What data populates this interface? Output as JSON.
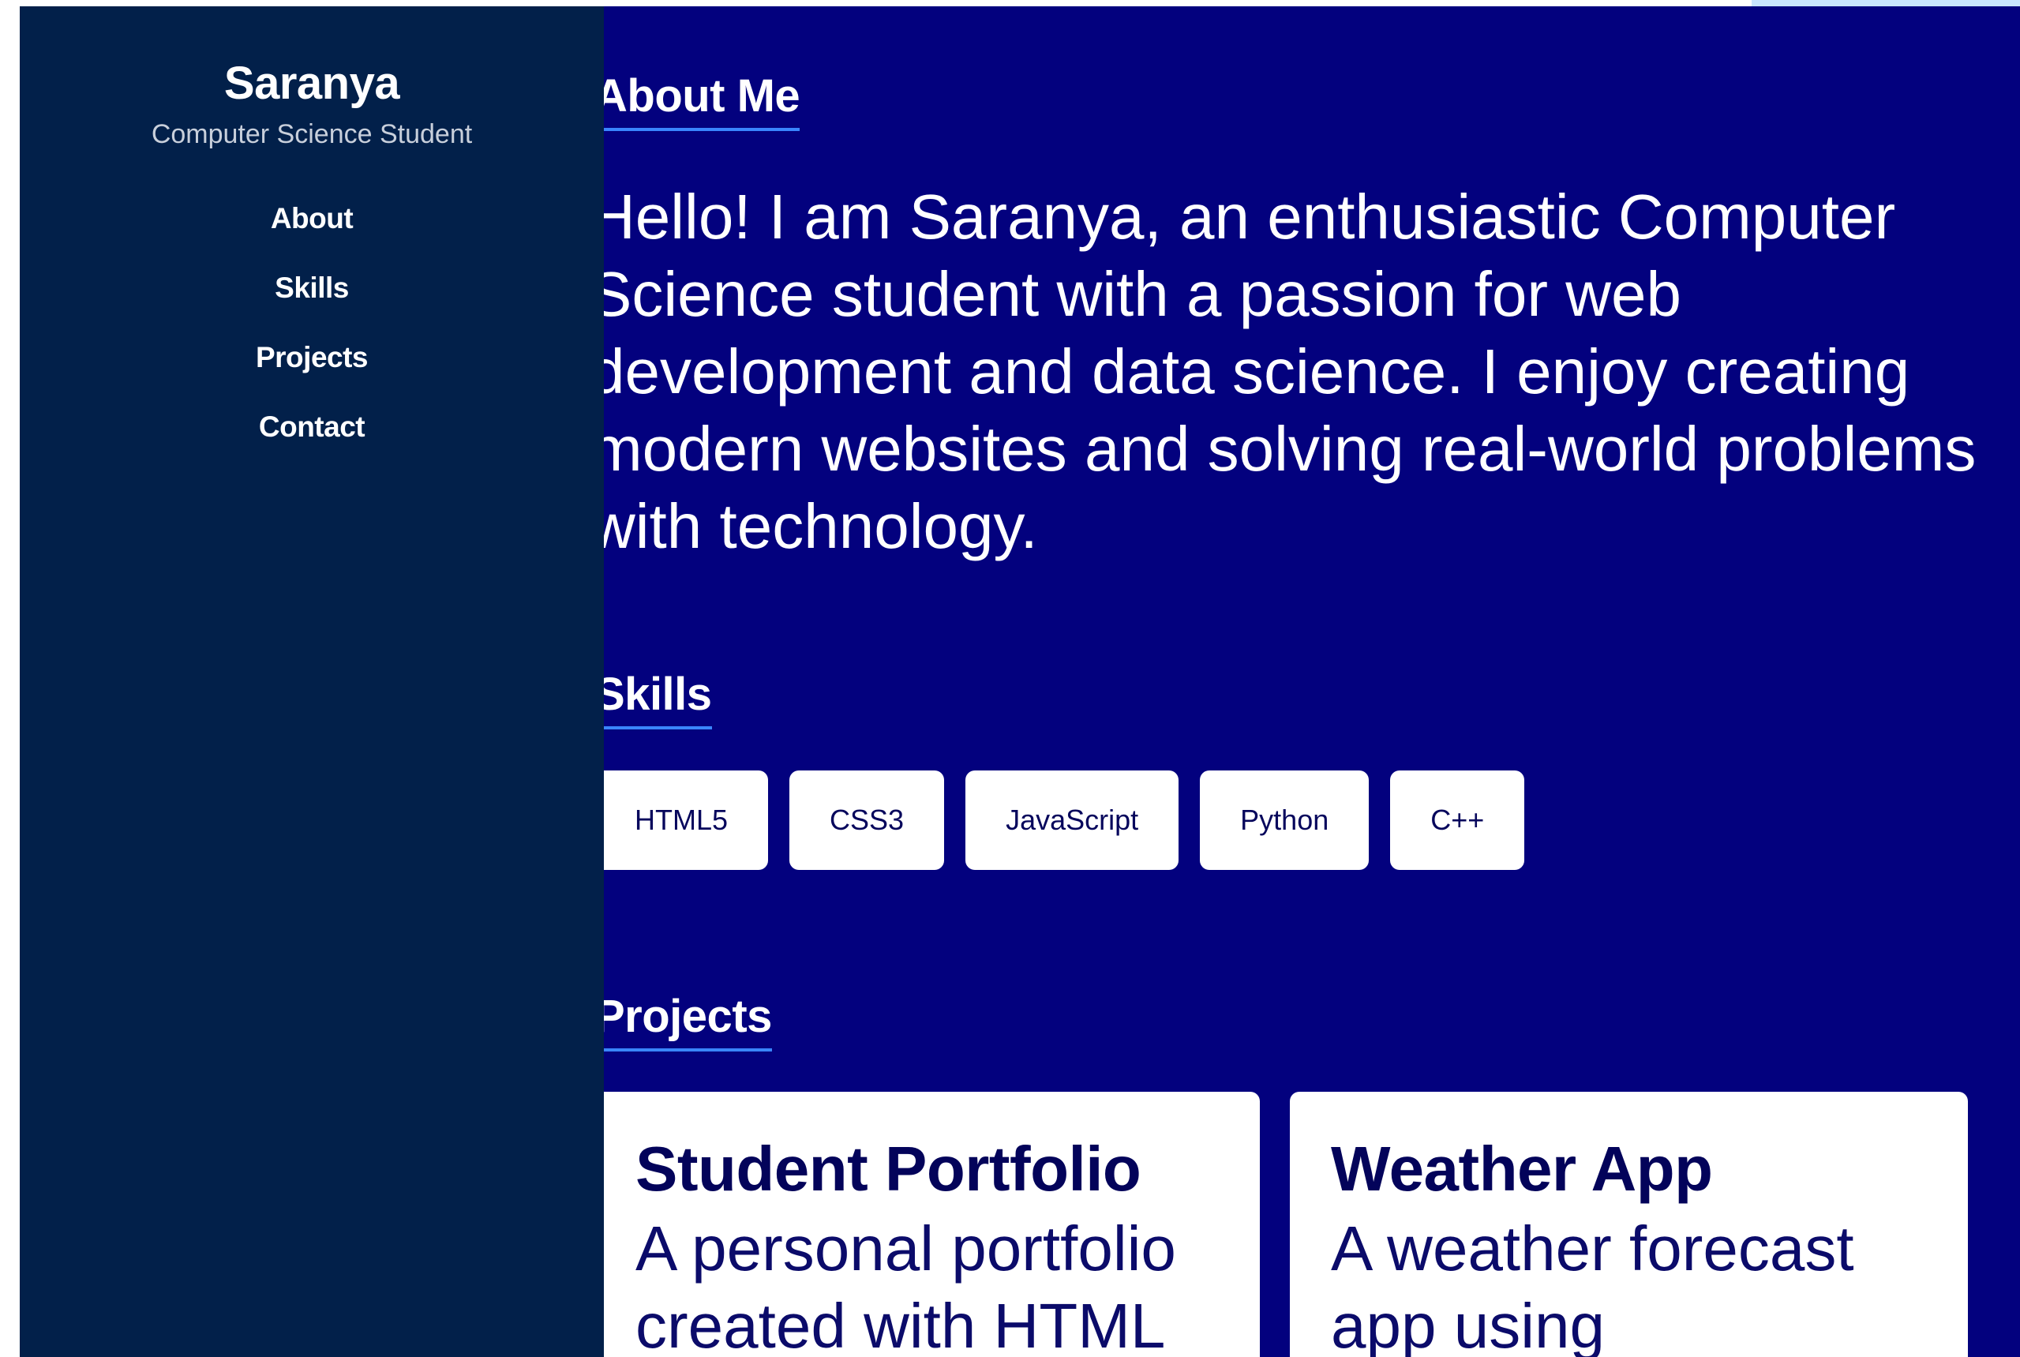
{
  "sidebar": {
    "name": "Saranya",
    "subtitle": "Computer Science Student",
    "nav": [
      {
        "label": "About"
      },
      {
        "label": "Skills"
      },
      {
        "label": "Projects"
      },
      {
        "label": "Contact"
      }
    ]
  },
  "about": {
    "title": "About Me",
    "text": "Hello! I am Saranya, an enthusiastic Computer Science student with a passion for web development and data science. I enjoy creating modern websites and solving real-world problems with technology."
  },
  "skills": {
    "title": "Skills",
    "items": [
      "HTML5",
      "CSS3",
      "JavaScript",
      "Python",
      "C++"
    ]
  },
  "projects": {
    "title": "Projects",
    "items": [
      {
        "title": "Student Portfolio",
        "description": "A personal portfolio created with HTML"
      },
      {
        "title": "Weather App",
        "description": "A weather forecast app using"
      }
    ]
  },
  "colors": {
    "sidebar_bg": "#02204a",
    "main_bg": "#03017e",
    "accent_underline": "#3a86ff",
    "card_text": "#03035a"
  }
}
